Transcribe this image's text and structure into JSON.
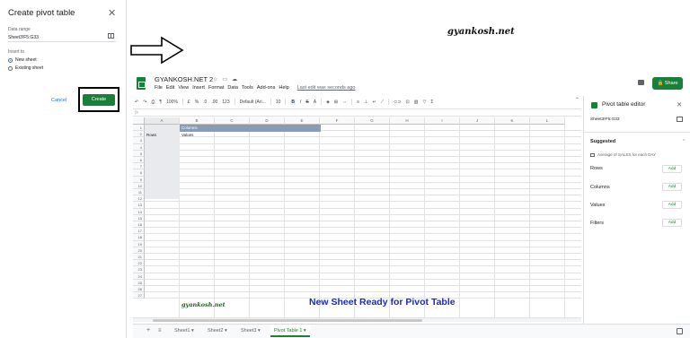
{
  "dialog": {
    "title": "Create pivot table",
    "range_label": "Data range",
    "range_value": "Sheet3!F5:G33",
    "insert_label": "Insert to",
    "options": [
      "New sheet",
      "Existing sheet"
    ],
    "selected_option": "New sheet",
    "cancel_label": "Cancel",
    "create_label": "Create"
  },
  "watermark_top": "gyankosh.net",
  "watermark_bottom": "gyankosh.net",
  "banner": "New Sheet Ready for Pivot Table",
  "doc": {
    "title": "GYANKOSH.NET 2",
    "menus": [
      "File",
      "Edit",
      "View",
      "Insert",
      "Format",
      "Data",
      "Tools",
      "Add-ons",
      "Help"
    ],
    "last_edit": "Last edit was seconds ago",
    "share_label": "Share"
  },
  "toolbar": {
    "zoom": "100%",
    "currency": "£",
    "percent": "%",
    "dec_less": ".0",
    "dec_more": ".00",
    "more_formats": "123",
    "font": "Default (Ari...",
    "font_size": "10",
    "bold": "B",
    "italic": "I",
    "strike": "S",
    "text_color": "A",
    "sum": "Σ"
  },
  "grid": {
    "columns": [
      "A",
      "B",
      "C",
      "D",
      "E",
      "F",
      "G",
      "H",
      "I",
      "J",
      "K",
      "L"
    ],
    "rows": [
      "1",
      "2",
      "3",
      "4",
      "5",
      "6",
      "7",
      "8",
      "9",
      "10",
      "11",
      "12",
      "13",
      "14",
      "15",
      "16",
      "17",
      "18",
      "19",
      "20",
      "21",
      "22",
      "23",
      "24",
      "25",
      "26",
      "27"
    ],
    "cell_b1": "Columns",
    "cell_a2": "Rows",
    "cell_b2": "Values"
  },
  "tabs": {
    "items": [
      "Sheet1",
      "Sheet2",
      "Sheet3",
      "Pivot Table 1"
    ],
    "active": "Pivot Table 1"
  },
  "editor": {
    "title": "Pivot table editor",
    "range_value": "Sheet3!F5:G33",
    "suggested_label": "Suggested",
    "suggestion": "Average of SALES for each DAY",
    "sections": [
      "Rows",
      "Columns",
      "Values",
      "Filters"
    ],
    "add_label": "Add"
  },
  "colors": {
    "accent_green": "#188038",
    "pivot_header": "#8a9bb6",
    "banner_blue": "#1a2bb8"
  }
}
